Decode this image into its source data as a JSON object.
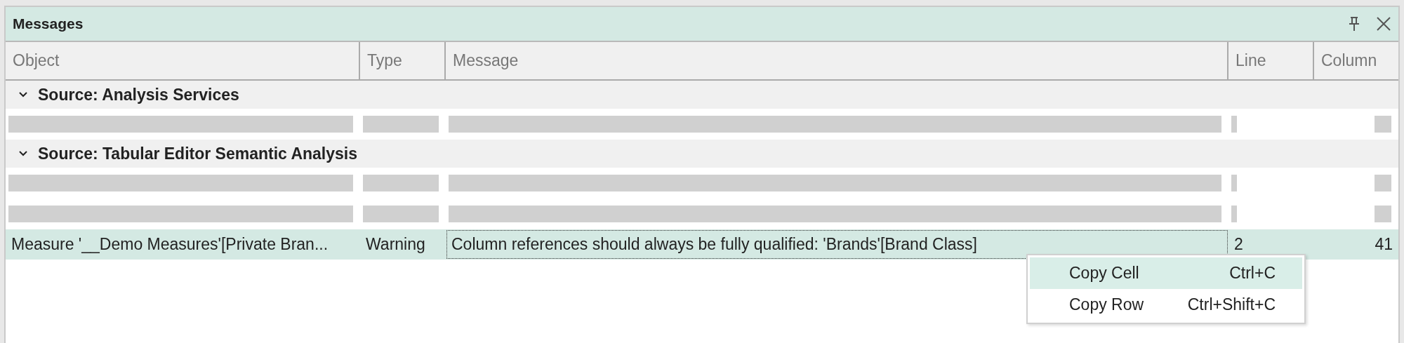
{
  "window": {
    "title": "Messages"
  },
  "table": {
    "columns": [
      "Object",
      "Type",
      "Message",
      "Line",
      "Column"
    ],
    "groups": [
      {
        "label": "Source: Analysis Services",
        "expanded": true,
        "rows": [
          {
            "kind": "redacted",
            "selected": false
          }
        ]
      },
      {
        "label": "Source: Tabular Editor Semantic Analysis",
        "expanded": true,
        "rows": [
          {
            "kind": "redacted",
            "selected": false
          },
          {
            "kind": "redacted",
            "selected": false
          },
          {
            "kind": "message",
            "selected": true,
            "cells": [
              "Measure '__Demo Measures'[Private Bran...",
              "Warning",
              "Column references should always be fully qualified: 'Brands'[Brand Class]",
              "2",
              "41"
            ]
          }
        ]
      }
    ]
  },
  "context_menu": {
    "items": [
      {
        "label": "Copy Cell",
        "shortcut": "Ctrl+C",
        "selected": true
      },
      {
        "label": "Copy Row",
        "shortcut": "Ctrl+Shift+C",
        "selected": false
      }
    ]
  }
}
